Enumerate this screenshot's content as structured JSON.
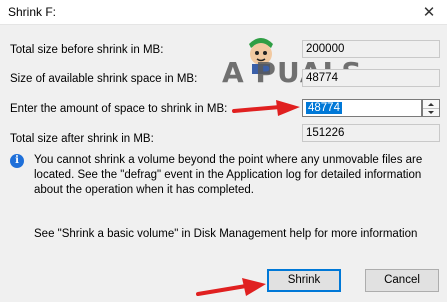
{
  "window": {
    "title": "Shrink F:",
    "close_glyph": "✕"
  },
  "watermark": {
    "text": "A  PUALS"
  },
  "rows": [
    {
      "label": "Total size before shrink in MB:",
      "value": "200000"
    },
    {
      "label": "Size of available shrink space in MB:",
      "value": "48774"
    },
    {
      "label": "Enter the amount of space to shrink in MB:",
      "value": "48774"
    },
    {
      "label": "Total size after shrink in MB:",
      "value": "151226"
    }
  ],
  "info": {
    "icon": "info-icon",
    "text": "You cannot shrink a volume beyond the point where any unmovable files are located. See the \"defrag\" event in the Application log for detailed information about the operation when it has completed."
  },
  "help": {
    "text": "See \"Shrink a basic volume\" in Disk Management help for more information"
  },
  "buttons": {
    "shrink": "Shrink",
    "cancel": "Cancel"
  },
  "colors": {
    "selection": "#0078d7",
    "annotation_arrow": "#e02020",
    "info_icon": "#1e6fd9"
  }
}
